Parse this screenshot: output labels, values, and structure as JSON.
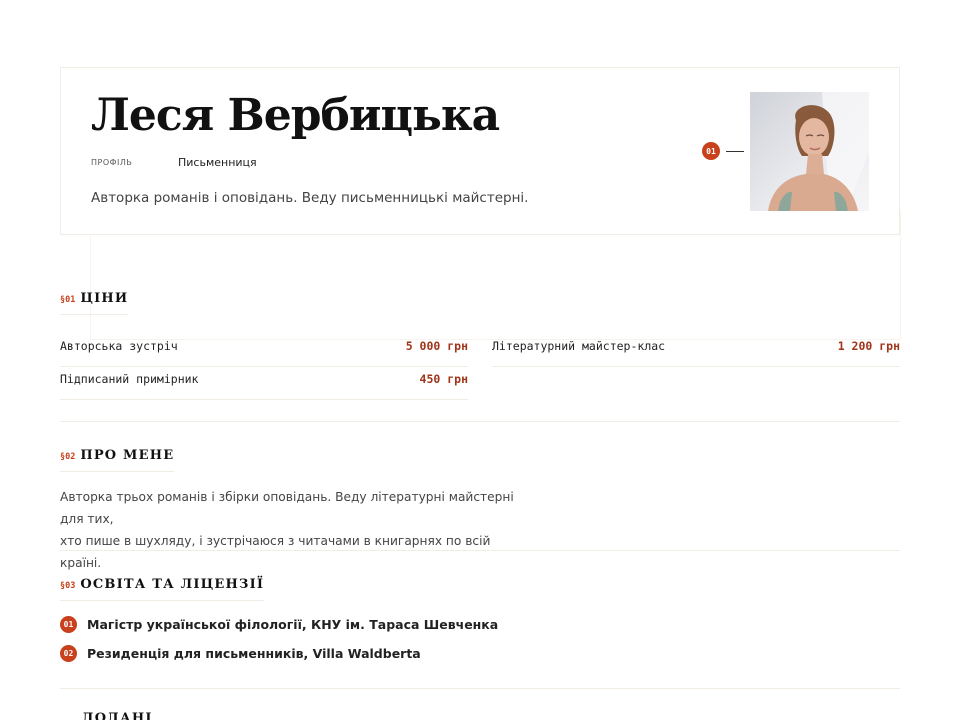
{
  "profile": {
    "name": "Леся Вербицька",
    "label": "ПРОФІЛЬ",
    "role": "Письменниця",
    "tagline": "Авторка романів і оповідань. Веду письменницькі майстерні.",
    "photo_marker": "01"
  },
  "sections": {
    "prices": {
      "num": "§01",
      "title": "ЦІНИ"
    },
    "about": {
      "num": "§02",
      "title": "ПРО МЕНЕ"
    },
    "education": {
      "num": "§03",
      "title": "ОСВІТА ТА ЛІЦЕНЗІЇ"
    },
    "next": {
      "title": "ДОДАНІ"
    }
  },
  "prices": [
    {
      "name": "Авторська зустріч",
      "value": "5 000 грн"
    },
    {
      "name": "Літературний майстер-клас",
      "value": "1 200 грн"
    },
    {
      "name": "Підписаний примірник",
      "value": "450 грн"
    }
  ],
  "about": {
    "line1": "Авторка трьох романів і збірки оповідань. Веду літературні майстерні для тих,",
    "line2": "хто пише в шухляду, і зустрічаюся з читачами в книгарнях по всій країні."
  },
  "education": [
    {
      "num": "01",
      "text": "Магістр української філології, КНУ ім. Тараса Шевченка"
    },
    {
      "num": "02",
      "text": "Резиденція для письменників, Villa Waldberta"
    }
  ],
  "colors": {
    "accent": "#c8401c",
    "price": "#a0351a",
    "border": "#f1ede4"
  }
}
